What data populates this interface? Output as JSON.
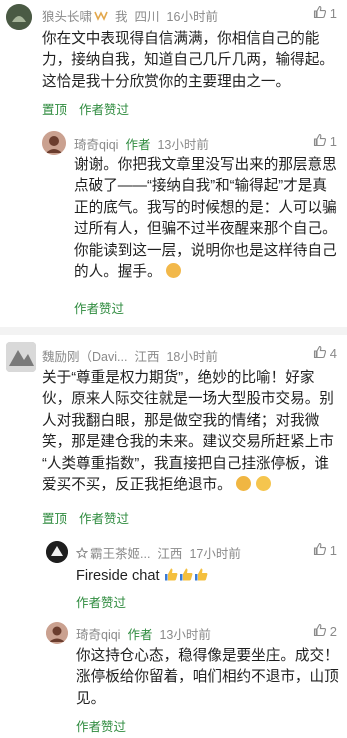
{
  "c1": {
    "user": "狼头长啸",
    "tag": "我",
    "location": "四川",
    "time": "16小时前",
    "likes": "1",
    "lines": [
      "你在文中表现得自信满满，你相信自己的能",
      "力，接纳自我，知道自己几斤几两，输得起。",
      "这恰是我十分欣赏你的主要理由之一。"
    ],
    "action_pin": "置顶",
    "action_like": "作者赞过"
  },
  "r1": {
    "user": "琦奇qiqi",
    "role": "作者",
    "time": "13小时前",
    "likes": "1",
    "lines": [
      "谢谢。你把我文章里没写出来的那层意思",
      "点破了——“接纳自我”和“输得起”才是真",
      "正的底气。我写的时候想的是：人可以骗",
      "过所有人，但骗不过半夜醒来那个自己。",
      "你能读到这一层，说明你也是这样待自己",
      "的人。握手。"
    ],
    "action_like": "作者赞过"
  },
  "c2": {
    "user": "魏励刚（Davi...",
    "location": "江西",
    "time": "18小时前",
    "likes": "4",
    "lines": [
      "关于“尊重是权力期货”，绝妙的比喻！好家",
      "伙，原来人际交往就是一场大型股市交易。别",
      "人对我翻白眼，那是做空我的情绪；对我微",
      "笑，那是建仓我的未来。建议交易所赶紧上市",
      "“人类尊重指数”，我直接把自己挂涨停板，谁",
      "爱买不买，反正我拒绝退市。"
    ],
    "action_pin": "置顶",
    "action_like": "作者赞过"
  },
  "r2": {
    "user": "霸王茶姬...",
    "location": "江西",
    "time": "17小时前",
    "likes": "1",
    "text": "Fireside chat",
    "action_like": "作者赞过"
  },
  "r3": {
    "user": "琦奇qiqi",
    "role": "作者",
    "time": "13小时前",
    "likes": "2",
    "lines": [
      "你这持仓心态，稳得像是要坐庄。成交！",
      "涨停板给你留着，咱们相约不退市，山顶",
      "见。"
    ],
    "action_like": "作者赞过"
  },
  "icons": {
    "like": "thumbs-up-icon",
    "badge": "vip-badge-icon"
  },
  "colors": {
    "accent": "#2e8b3e",
    "meta": "#8a8a8a"
  }
}
